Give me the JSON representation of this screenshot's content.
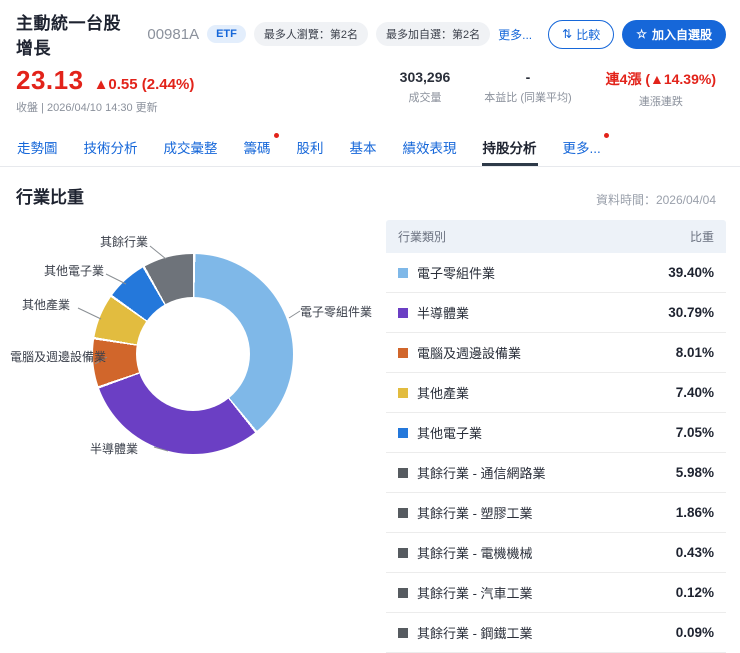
{
  "header": {
    "title": "主動統一台股增長",
    "code": "00981A",
    "etf_badge": "ETF",
    "badges": [
      "最多人瀏覽：第2名",
      "最多加自選：第2名"
    ],
    "more_link": "更多...",
    "compare_button": "比較",
    "compare_icon": "⇅",
    "add_watchlist_button": "加入自選股",
    "add_watchlist_icon": "☆"
  },
  "quote": {
    "price": "23.13",
    "change": "▲0.55 (2.44%)",
    "status_line": "收盤 | 2026/04/10 14:30 更新",
    "volume_value": "303,296",
    "volume_label": "成交量",
    "pe_value": "-",
    "pe_label": "本益比 (同業平均)",
    "streak_value": "連4漲 (▲14.39%)",
    "streak_label": "連漲連跌"
  },
  "tabs": [
    {
      "label": "走勢圖",
      "active": false,
      "dot": false
    },
    {
      "label": "技術分析",
      "active": false,
      "dot": false
    },
    {
      "label": "成交彙整",
      "active": false,
      "dot": false
    },
    {
      "label": "籌碼",
      "active": false,
      "dot": true
    },
    {
      "label": "股利",
      "active": false,
      "dot": false
    },
    {
      "label": "基本",
      "active": false,
      "dot": false
    },
    {
      "label": "績效表現",
      "active": false,
      "dot": false
    },
    {
      "label": "持股分析",
      "active": true,
      "dot": false
    },
    {
      "label": "更多...",
      "active": false,
      "dot": true
    }
  ],
  "section": {
    "title": "行業比重",
    "data_time": "資料時間：2026/04/04"
  },
  "chart_data": {
    "type": "pie",
    "title": "行業比重",
    "slices": [
      {
        "label": "電子零組件業",
        "value": 39.4,
        "color": "#7fb8e8"
      },
      {
        "label": "半導體業",
        "value": 30.79,
        "color": "#6b3fc4"
      },
      {
        "label": "電腦及週邊設備業",
        "value": 8.01,
        "color": "#d1662b"
      },
      {
        "label": "其他產業",
        "value": 7.4,
        "color": "#e2bc3f"
      },
      {
        "label": "其他電子業",
        "value": 7.05,
        "color": "#2478db"
      },
      {
        "label": "其餘行業",
        "value": 8.48,
        "color": "#6e737a"
      }
    ]
  },
  "industry_table": {
    "headers": [
      "行業類別",
      "比重"
    ],
    "rows": [
      {
        "label": "電子零組件業",
        "value": "39.40%",
        "color": "#7fb8e8"
      },
      {
        "label": "半導體業",
        "value": "30.79%",
        "color": "#6b3fc4"
      },
      {
        "label": "電腦及週邊設備業",
        "value": "8.01%",
        "color": "#d1662b"
      },
      {
        "label": "其他產業",
        "value": "7.40%",
        "color": "#e2bc3f"
      },
      {
        "label": "其他電子業",
        "value": "7.05%",
        "color": "#2478db"
      },
      {
        "label": "其餘行業 - 通信網路業",
        "value": "5.98%",
        "color": "#565b60"
      },
      {
        "label": "其餘行業 - 塑膠工業",
        "value": "1.86%",
        "color": "#565b60"
      },
      {
        "label": "其餘行業 - 電機機械",
        "value": "0.43%",
        "color": "#565b60"
      },
      {
        "label": "其餘行業 - 汽車工業",
        "value": "0.12%",
        "color": "#565b60"
      },
      {
        "label": "其餘行業 - 鋼鐵工業",
        "value": "0.09%",
        "color": "#565b60"
      }
    ]
  }
}
